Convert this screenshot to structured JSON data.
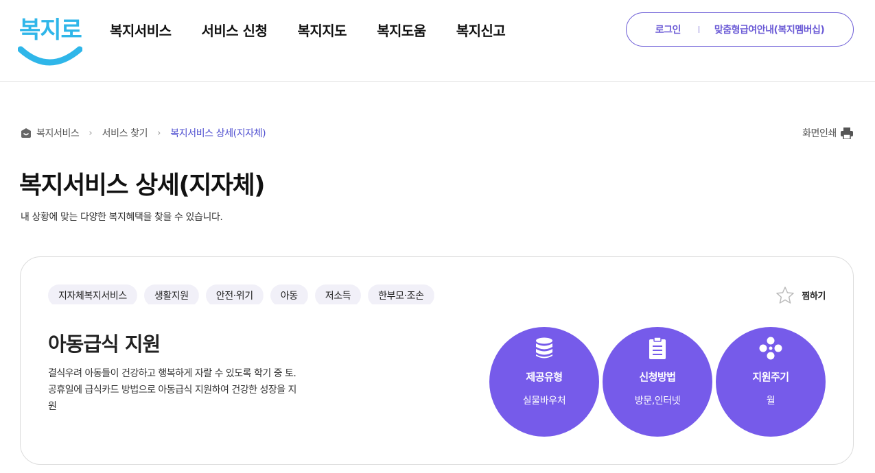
{
  "header": {
    "logo_text": "복지로",
    "nav": [
      "복지서비스",
      "서비스 신청",
      "복지지도",
      "복지도움",
      "복지신고"
    ],
    "login": "로그인",
    "membership": "맞춤형급여안내(복지멤버십)"
  },
  "breadcrumb": {
    "items": [
      "복지서비스",
      "서비스 찾기",
      "복지서비스 상세(지자체)"
    ],
    "print_label": "화면인쇄"
  },
  "page": {
    "title": "복지서비스 상세(지자체)",
    "subtitle": "내 상황에 맞는 다양한 복지혜택을 찾을 수 있습니다."
  },
  "service": {
    "tags": [
      "지자체복지서비스",
      "생활지원",
      "안전·위기",
      "아동",
      "저소득",
      "한부모·조손"
    ],
    "favorite_label": "찜하기",
    "title": "아동급식 지원",
    "description": "결식우려 아동들이 건강하고 행복하게 자랄 수 있도록 학기 중 토.공휴일에 급식카드 방법으로 아동급식 지원하여 건강한 성장을 지원",
    "info": [
      {
        "icon": "database-icon",
        "label": "제공유형",
        "value": "실물바우처"
      },
      {
        "icon": "clipboard-icon",
        "label": "신청방법",
        "value": "방문,인터넷"
      },
      {
        "icon": "cycle-icon",
        "label": "지원주기",
        "value": "월"
      }
    ]
  },
  "colors": {
    "accent": "#765bea",
    "logo": "#2fb6e9",
    "link": "#4f4fd0"
  }
}
